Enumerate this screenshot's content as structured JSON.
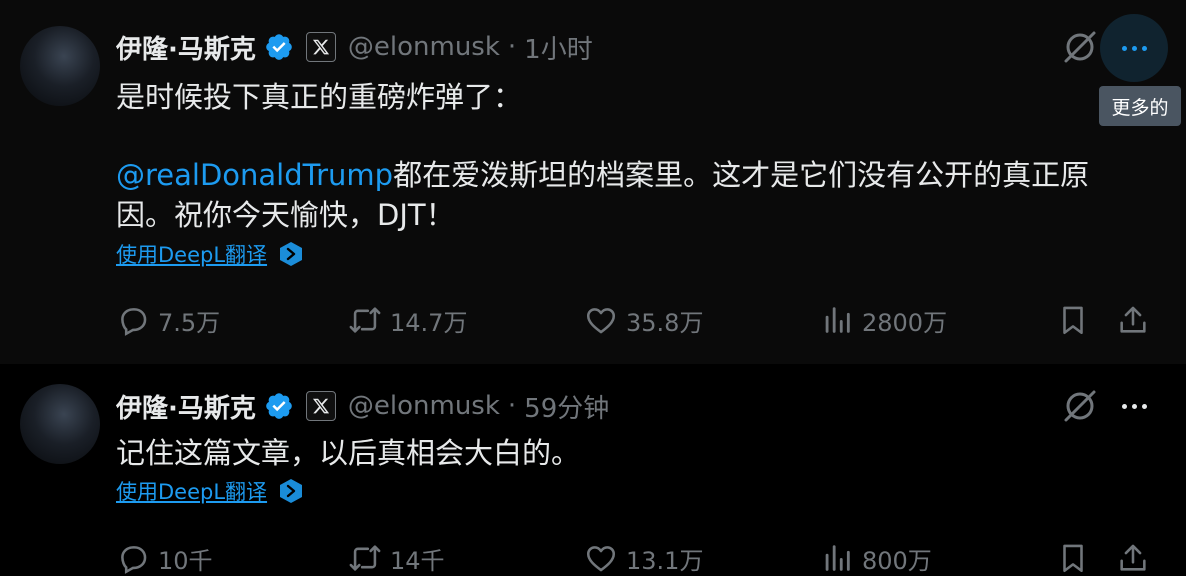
{
  "tweets": [
    {
      "author": {
        "display_name": "伊隆·马斯克",
        "handle": "@elonmusk"
      },
      "separator": "·",
      "time": "1小时",
      "text_line1": "是时候投下真正的重磅炸弹了：",
      "mention": "@realDonaldTrump",
      "text_line2_rest": "都在爱泼斯坦的档案里。这才是它们没有公开的真正原",
      "text_line3": "因。祝你今天愉快，DJT！",
      "translate_label": "使用DeepL翻译",
      "stats": {
        "replies": "7.5万",
        "retweets": "14.7万",
        "likes": "35.8万",
        "views": "2800万"
      }
    },
    {
      "author": {
        "display_name": "伊隆·马斯克",
        "handle": "@elonmusk"
      },
      "separator": "·",
      "time": "59分钟",
      "text_line1": "记住这篇文章，以后真相会大白的。",
      "translate_label": "使用DeepL翻译",
      "stats": {
        "replies": "10千",
        "retweets": "14千",
        "likes": "13.1万",
        "views": "800万"
      }
    }
  ],
  "tooltip": {
    "more_label": "更多的"
  },
  "colors": {
    "accent": "#1d9bf0",
    "muted": "#71767b",
    "text": "#e7e9ea",
    "background": "#000000"
  },
  "icons": [
    "verified-badge-icon",
    "x-logo-icon",
    "grok-icon",
    "more-icon",
    "deepl-icon",
    "reply-icon",
    "retweet-icon",
    "like-icon",
    "views-icon",
    "bookmark-icon",
    "share-icon"
  ]
}
